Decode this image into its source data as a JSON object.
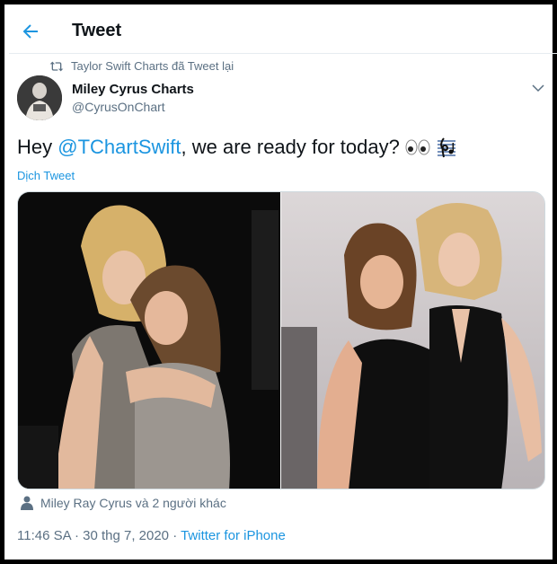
{
  "header": {
    "title": "Tweet"
  },
  "retweet": {
    "text": "Taylor Swift Charts đã Tweet lại"
  },
  "author": {
    "name": "Miley Cyrus Charts",
    "handle": "@CyrusOnChart"
  },
  "tweet": {
    "prefix": "Hey ",
    "mention": "@TChartSwift",
    "suffix": ", we are ready for today?",
    "emojis": [
      "eyes-emoji",
      "musical-score-emoji"
    ]
  },
  "translate_label": "Dịch Tweet",
  "likers": {
    "text": "Miley Ray Cyrus và 2 người khác"
  },
  "meta": {
    "timestamp": "11:46 SA · 30 thg 7, 2020 · ",
    "source": "Twitter for iPhone"
  },
  "colors": {
    "accent": "#1b95e0",
    "muted": "#5b7083",
    "text": "#0f1419"
  }
}
